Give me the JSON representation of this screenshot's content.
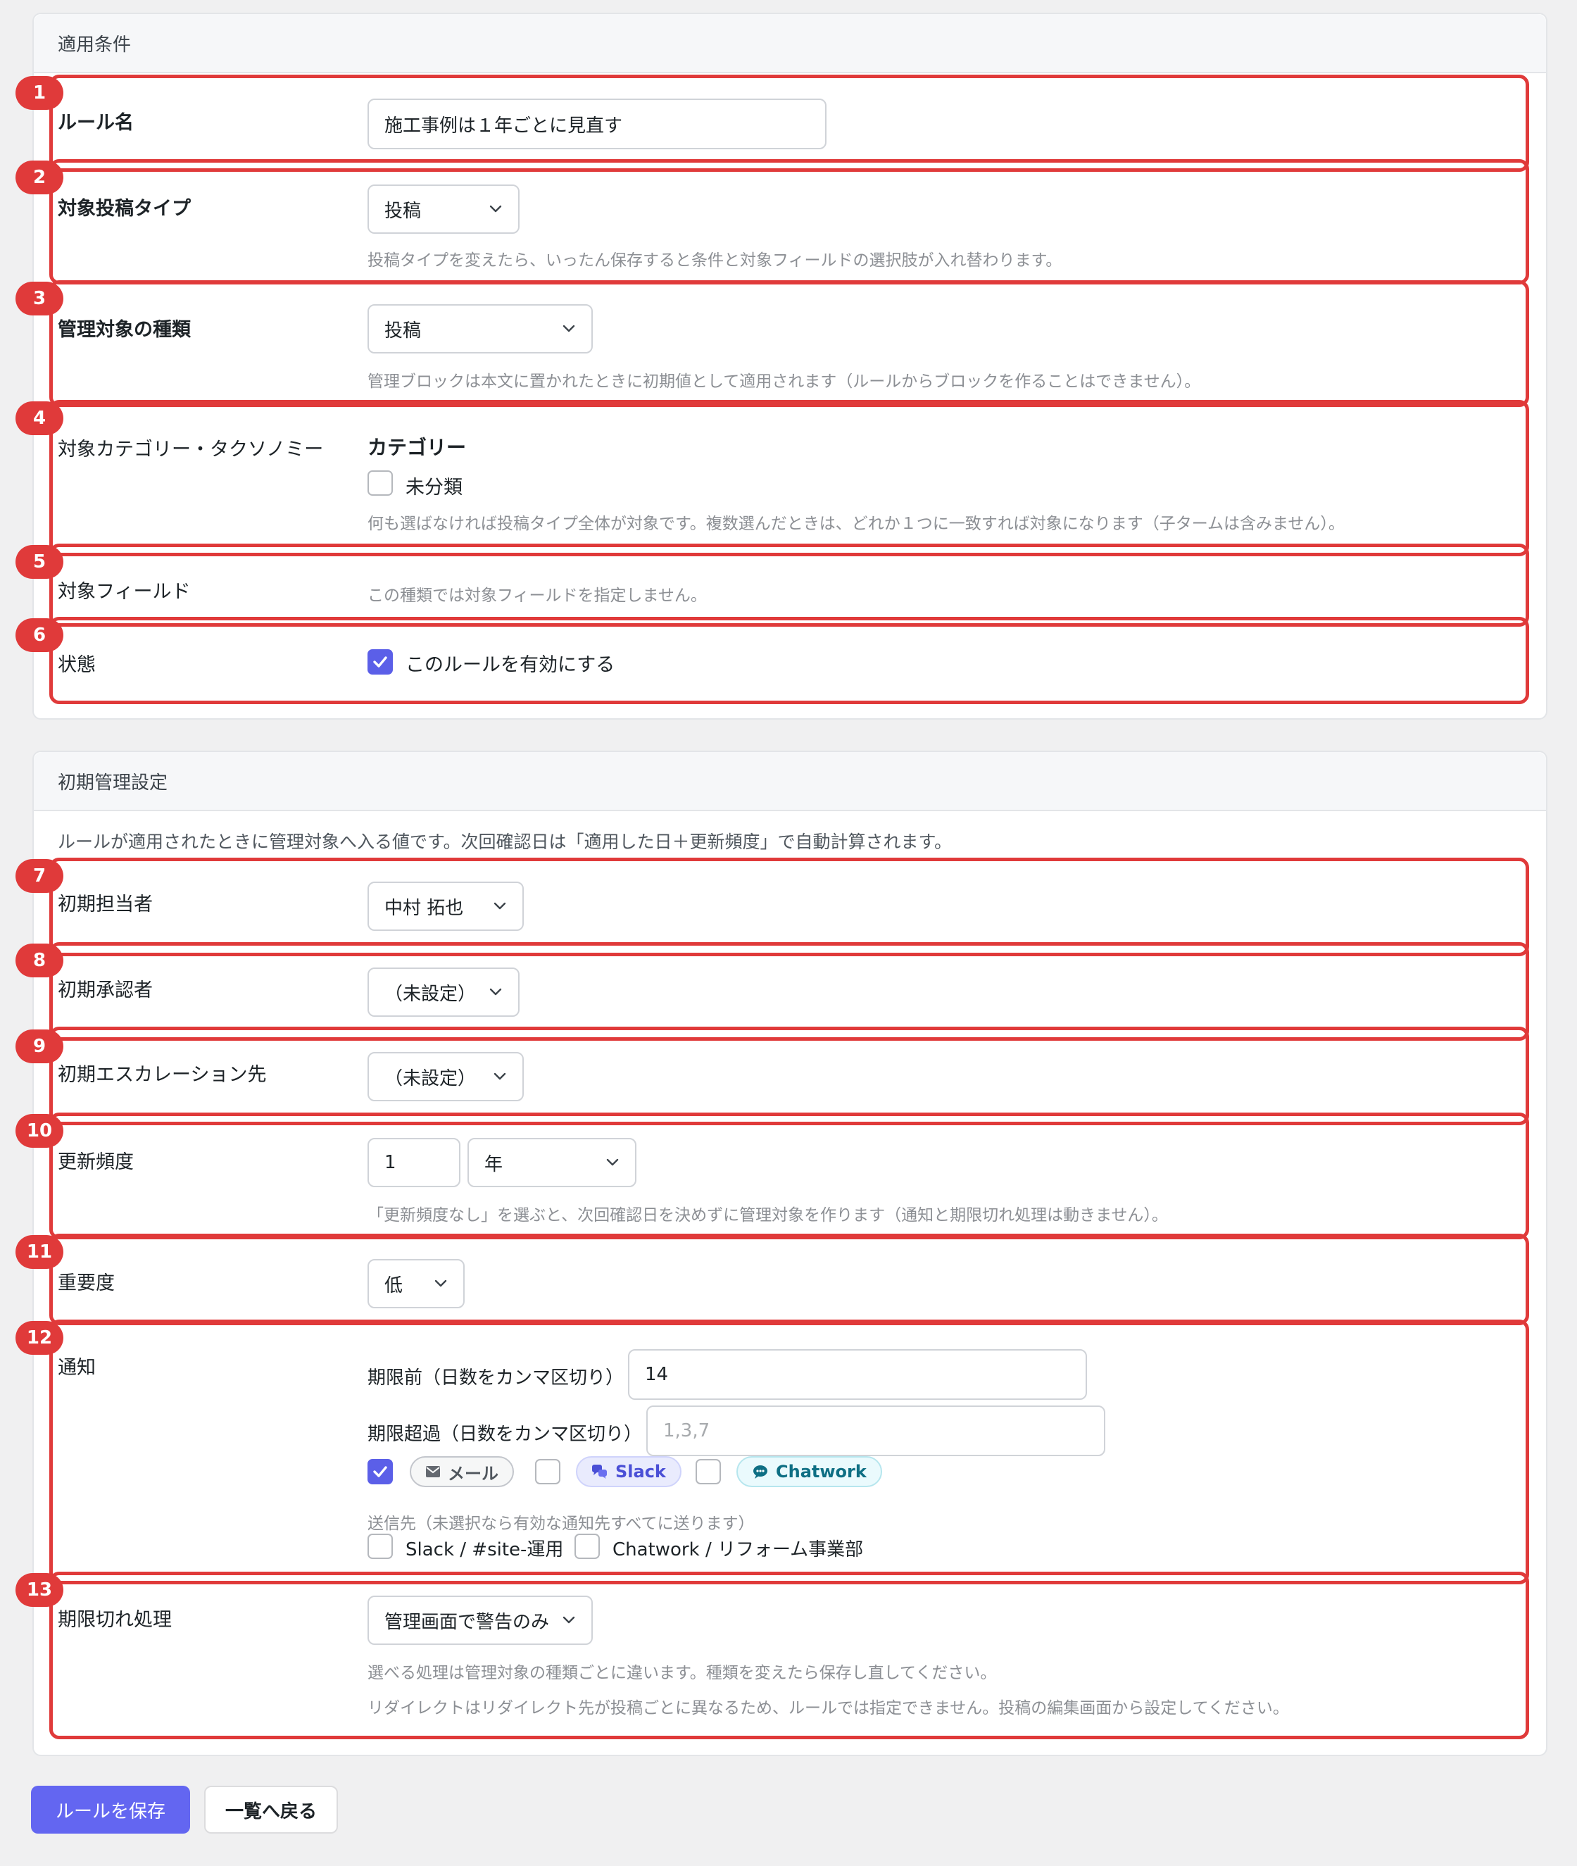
{
  "panel1": {
    "title": "適用条件",
    "rows": [
      {
        "badge": "1",
        "label": "ルール名",
        "value": "施工事例は１年ごとに見直す"
      },
      {
        "badge": "2",
        "label": "対象投稿タイプ",
        "select": "投稿",
        "help": "投稿タイプを変えたら、いったん保存すると条件と対象フィールドの選択肢が入れ替わります。"
      },
      {
        "badge": "3",
        "label": "管理対象の種類",
        "select": "投稿",
        "help": "管理ブロックは本文に置かれたときに初期値として適用されます（ルールからブロックを作ることはできません）。"
      },
      {
        "badge": "4",
        "label": "対象カテゴリー・タクソノミー",
        "group_title": "カテゴリー",
        "option": "未分類",
        "help": "何も選ばなければ投稿タイプ全体が対象です。複数選んだときは、どれか１つに一致すれば対象になります（子タームは含みません）。"
      },
      {
        "badge": "5",
        "label": "対象フィールド",
        "help": "この種類では対象フィールドを指定しません。"
      },
      {
        "badge": "6",
        "label": "状態",
        "checkbox": "このルールを有効にする"
      }
    ]
  },
  "panel2": {
    "title": "初期管理設定",
    "intro": "ルールが適用されたときに管理対象へ入る値です。次回確認日は「適用した日＋更新頻度」で自動計算されます。",
    "rows": [
      {
        "badge": "7",
        "label": "初期担当者",
        "select": "中村 拓也"
      },
      {
        "badge": "8",
        "label": "初期承認者",
        "select": "（未設定）"
      },
      {
        "badge": "9",
        "label": "初期エスカレーション先",
        "select": "（未設定）"
      },
      {
        "badge": "10",
        "label": "更新頻度",
        "number": "1",
        "unit": "年",
        "help": "「更新頻度なし」を選ぶと、次回確認日を決めずに管理対象を作ります（通知と期限切れ処理は動きません）。"
      },
      {
        "badge": "11",
        "label": "重要度",
        "select": "低"
      },
      {
        "badge": "12",
        "label": "通知",
        "before_label": "期限前（日数をカンマ区切り）",
        "before_value": "14",
        "after_label": "期限超過（日数をカンマ区切り）",
        "after_placeholder": "1,3,7",
        "channel_mail": "メール",
        "channel_slack": "Slack",
        "channel_chatwork": "Chatwork",
        "dest_help": "送信先（未選択なら有効な通知先すべてに送ります）",
        "dest_slack": "Slack / #site-運用",
        "dest_chatwork": "Chatwork / リフォーム事業部"
      },
      {
        "badge": "13",
        "label": "期限切れ処理",
        "select": "管理画面で警告のみ",
        "help1": "選べる処理は管理対象の種類ごとに違います。種類を変えたら保存し直してください。",
        "help2": "リダイレクトはリダイレクト先が投稿ごとに異なるため、ルールでは指定できません。投稿の編集画面から設定してください。"
      }
    ]
  },
  "actions": {
    "save": "ルールを保存",
    "back": "一覧へ戻る"
  },
  "colors": {
    "accent": "#5b5fe8",
    "highlight": "#e03a3a"
  }
}
